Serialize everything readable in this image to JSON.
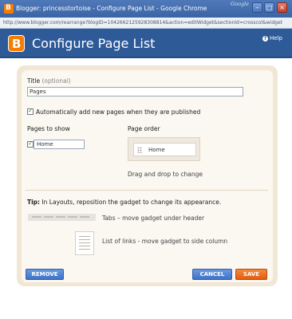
{
  "window": {
    "title": "Blogger: princesstortoise - Configure Page List - Google Chrome",
    "google_label": "Google",
    "url": "http://www.blogger.com/rearrange?blogID=1042662125928308814&action=editWidget&sectionId=crosscol&widget"
  },
  "header": {
    "title": "Configure Page List",
    "help": "Help"
  },
  "form": {
    "title_label": "Title",
    "title_optional": "(optional)",
    "title_value": "Pages",
    "auto_add_label": "Automatically add new pages when they are published",
    "auto_add_checked": true,
    "pages_to_show_label": "Pages to show",
    "page_order_label": "Page order",
    "pages": [
      {
        "name": "Home",
        "checked": true
      }
    ],
    "page_order": [
      "Home"
    ],
    "drag_hint": "Drag and drop to change"
  },
  "tip": {
    "prefix": "Tip:",
    "text": "In Layouts, reposition the gadget to change its appearance.",
    "tabs_desc": "Tabs – move gadget under header",
    "list_desc": "List of links - move gadget to side column"
  },
  "buttons": {
    "remove": "REMOVE",
    "cancel": "CANCEL",
    "save": "SAVE"
  },
  "colors": {
    "header_blue": "#2e5a98",
    "save_orange": "#e15d0f",
    "button_blue": "#3e72c6",
    "panel_beige": "#f2e6d5"
  }
}
